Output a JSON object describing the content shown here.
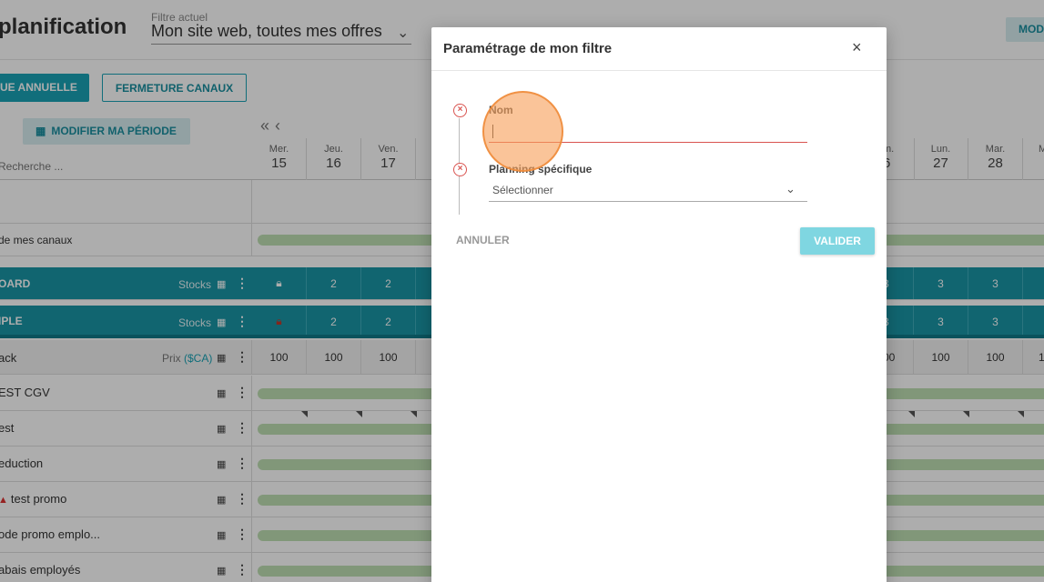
{
  "header": {
    "title": "planification",
    "filter_label": "Filtre actuel",
    "filter_value": "Mon site web, toutes mes offres",
    "top_right_button": "MOD"
  },
  "toolbar": {
    "annual_button": "UE ANNUELLE",
    "fermeture_button": "FERMETURE CANAUX",
    "periode_button": "MODIFIER MA PÉRIODE",
    "search_placeholder": "Recherche ..."
  },
  "days": [
    {
      "name": "Mer.",
      "num": "15"
    },
    {
      "name": "Jeu.",
      "num": "16"
    },
    {
      "name": "Ven.",
      "num": "17"
    }
  ],
  "days_right": [
    {
      "name": "m.",
      "num": "6"
    },
    {
      "name": "Lun.",
      "num": "27"
    },
    {
      "name": "Mar.",
      "num": "28"
    },
    {
      "name": "M",
      "num": ""
    }
  ],
  "rows": {
    "canaux": "de mes canaux",
    "board": {
      "label": "OARD",
      "sub": "Stocks",
      "values": [
        "",
        "2",
        "2"
      ],
      "values_right": [
        "3",
        "3",
        "3"
      ]
    },
    "iple": {
      "label": "IPLE",
      "sub": "Stocks",
      "values": [
        "",
        "2",
        "2"
      ],
      "values_right": [
        "3",
        "3",
        "3"
      ]
    },
    "ack": {
      "label": "ack",
      "sub": "Prix",
      "currency": "($CA)",
      "values": [
        "100",
        "100",
        "100"
      ],
      "values_right": [
        "00",
        "100",
        "100",
        "1"
      ]
    },
    "test_cgv": "EST CGV",
    "test": "est",
    "reduction": "eduction",
    "test_promo": "test promo",
    "code_promo": "ode promo emplo...",
    "rabais": "abais employés"
  },
  "modal": {
    "title": "Paramétrage de mon filtre",
    "close": "×",
    "nom_label": "Nom",
    "nom_value": "",
    "planning_label": "Planning spécifique",
    "planning_placeholder": "Sélectionner",
    "cancel": "ANNULER",
    "submit": "VALIDER"
  },
  "colors": {
    "accent": "#1aa3b5",
    "error": "#d9534f",
    "bar_green": "#bfdfb3"
  }
}
